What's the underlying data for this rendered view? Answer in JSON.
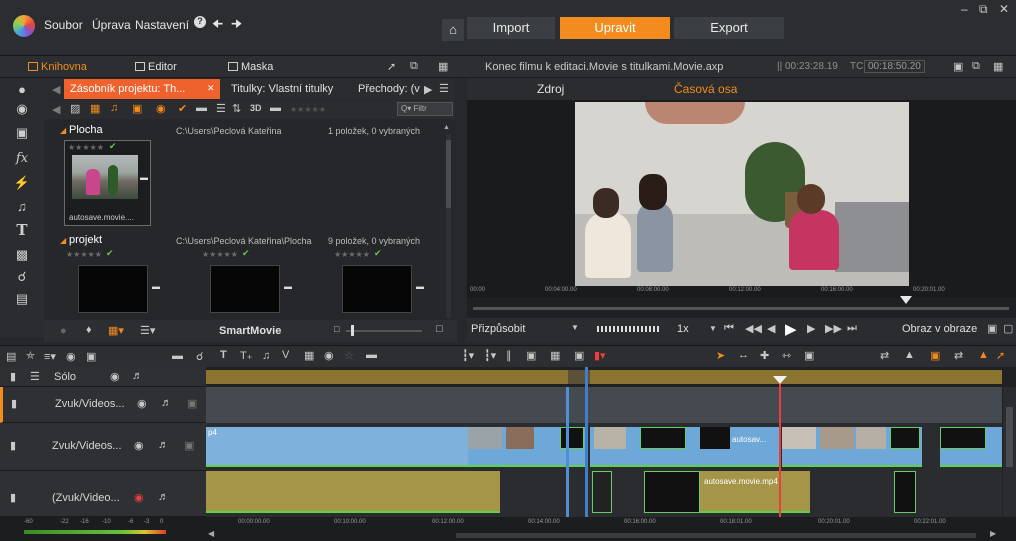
{
  "menu": {
    "items": [
      "Soubor",
      "Úprava",
      "Nastavení"
    ]
  },
  "nav": {
    "import": "Import",
    "edit": "Upravit",
    "export": "Export"
  },
  "library_tabs": {
    "library": "Knihovna",
    "editor": "Editor",
    "mask": "Maska"
  },
  "doc": {
    "title": "Konec filmu k editaci.Movie s titulkami.Movie.axp",
    "duration": "00:23:28.19",
    "tc_label": "TC",
    "tc": "00:18:50.20"
  },
  "lib_tabs": {
    "project_bin": "Zásobník projektu: Th...",
    "titles": "Titulky: Vlastní titulky",
    "transitions": "Přechody: (v"
  },
  "filter": "Filtr",
  "folders": [
    {
      "name": "Plocha",
      "path": "C:\\Users\\Peclová Kateřina",
      "count": "1 položek, 0 vybraných"
    },
    {
      "name": "projekt",
      "path": "C:\\Users\\Peclová Kateřina\\Plocha",
      "count": "9 položek, 0 vybraných"
    }
  ],
  "thumb_caption": "autosave.movie....",
  "smartmovie": "SmartMovie",
  "preview": {
    "source": "Zdroj",
    "timeline": "Časová osa",
    "fit": "Přizpůsobit",
    "speed": "1x",
    "pip": "Obraz v obraze"
  },
  "scrub_ticks": [
    "00:00",
    "00:04:00.00",
    "00:08:00.00",
    "00:12:00.00",
    "00:16:00.00",
    "00:20:01.00"
  ],
  "tracks": {
    "solo": "Sólo",
    "t1": "Zvuk/Videos...",
    "t2": "Zvuk/Videos...",
    "t3": "(Zvuk/Video..."
  },
  "clips": {
    "t2_left": "p4",
    "t2_right": "autosav...",
    "t3": "autosave.movie.mp4"
  },
  "audio_ticks": [
    "-60",
    "-22",
    "-16",
    "-10",
    "-6",
    "-3",
    "0"
  ],
  "tl_ticks": [
    "00:00:00.00",
    "00:10:00.00",
    "00:12:00.00",
    "00:14:00.00",
    "00:16:00.00",
    "00:18:01.00",
    "00:20:01.00",
    "00:22:01.00"
  ],
  "colors": {
    "accent": "#f28c1e",
    "video_clip": "#6ea8d8",
    "audio_clip": "#a59548",
    "playhead": "#e8403a"
  }
}
